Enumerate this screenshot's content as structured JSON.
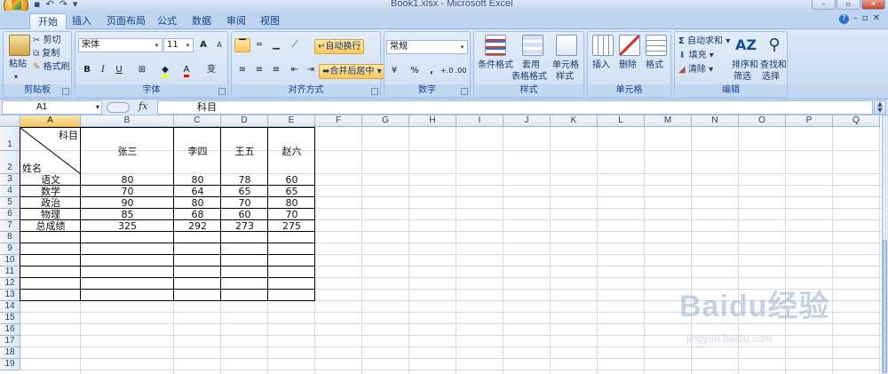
{
  "window": {
    "title": "Book1.xlsx - Microsoft Excel",
    "controls": {
      "minimize": "–",
      "restore": "▫",
      "close": "✕"
    }
  },
  "quick_access": {
    "icons": [
      "save-icon",
      "undo-icon",
      "redo-icon",
      "customize-icon"
    ]
  },
  "tabs": [
    {
      "label": "开始",
      "active": true
    },
    {
      "label": "插入",
      "active": false
    },
    {
      "label": "页面布局",
      "active": false
    },
    {
      "label": "公式",
      "active": false
    },
    {
      "label": "数据",
      "active": false
    },
    {
      "label": "审阅",
      "active": false
    },
    {
      "label": "视图",
      "active": false
    }
  ],
  "ribbon": {
    "clipboard": {
      "label": "剪贴板",
      "paste": "粘贴",
      "cut": "剪切",
      "copy": "复制",
      "format_painter": "格式刷"
    },
    "font": {
      "label": "字体",
      "font_name": "宋体",
      "font_size": "11",
      "grow": "A",
      "shrink": "A",
      "bold": "B",
      "italic": "I",
      "underline": "U",
      "phonetic": "变",
      "font_color": "A",
      "fill_color": "#ffff00",
      "text_color": "#ff0000"
    },
    "alignment": {
      "label": "对齐方式",
      "wrap_text": "自动换行",
      "merge_center": "合并后居中"
    },
    "number": {
      "label": "数字",
      "format": "常规",
      "percent": "%",
      "comma": ",",
      "inc_decimal": "+.0",
      "dec_decimal": ".00"
    },
    "styles": {
      "label": "样式",
      "conditional": "条件格式",
      "table_format_1": "套用",
      "table_format_2": "表格格式",
      "cell_styles_1": "单元格",
      "cell_styles_2": "样式"
    },
    "cells": {
      "label": "单元格",
      "insert": "插入",
      "delete": "删除",
      "format": "格式"
    },
    "editing": {
      "label": "编辑",
      "autosum": "自动求和",
      "fill": "填充",
      "clear": "清除",
      "sort_filter_1": "排序和",
      "sort_filter_2": "筛选",
      "find_select_1": "查找和",
      "find_select_2": "选择"
    }
  },
  "formula_bar": {
    "name_box": "A1",
    "fx": "fx",
    "content": "科目"
  },
  "sheet": {
    "columns": [
      "A",
      "B",
      "C",
      "D",
      "E",
      "F",
      "G",
      "H",
      "I",
      "J",
      "K",
      "L",
      "M",
      "N",
      "O",
      "P",
      "Q"
    ],
    "selected_column": "A",
    "rows": [
      "1",
      "2",
      "3",
      "4",
      "5",
      "6",
      "7",
      "8",
      "9",
      "10",
      "11",
      "12",
      "13",
      "14",
      "15",
      "16",
      "17",
      "18",
      "19"
    ],
    "header_cell": {
      "top_right": "科目",
      "bottom_left": "姓名"
    },
    "names": [
      "张三",
      "李四",
      "王五",
      "赵六"
    ],
    "table": [
      {
        "subject": "语文",
        "values": [
          "80",
          "80",
          "78",
          "60"
        ]
      },
      {
        "subject": "数学",
        "values": [
          "70",
          "64",
          "65",
          "65"
        ]
      },
      {
        "subject": "政治",
        "values": [
          "90",
          "80",
          "70",
          "80"
        ]
      },
      {
        "subject": "物理",
        "values": [
          "85",
          "68",
          "60",
          "70"
        ]
      },
      {
        "subject": "总成绩",
        "values": [
          "325",
          "292",
          "273",
          "275"
        ]
      }
    ]
  },
  "watermark": {
    "logo": "Baidu经验",
    "url": "jingyan.baidu.com"
  }
}
